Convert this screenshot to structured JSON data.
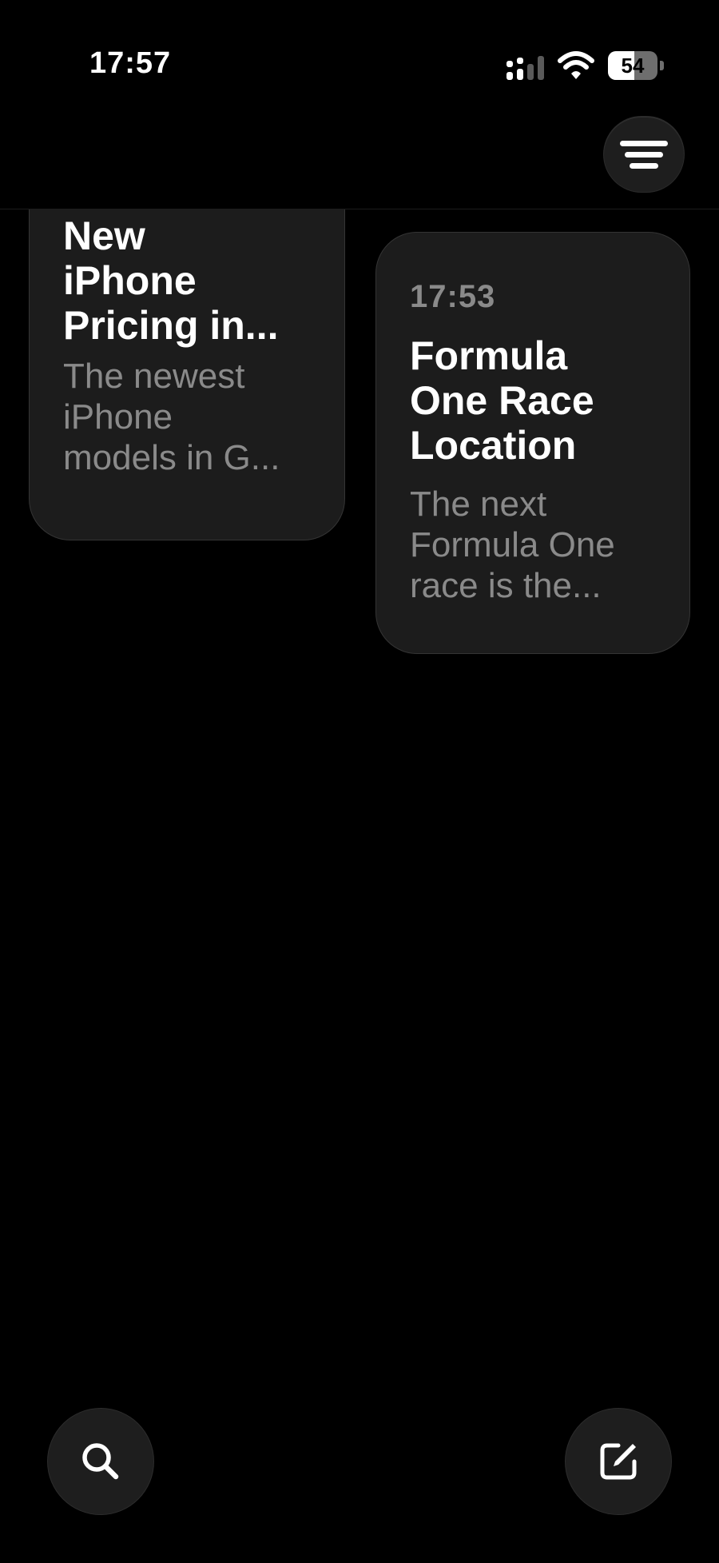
{
  "status_bar": {
    "time": "17:57",
    "battery_percent": "54",
    "battery_level": 54,
    "icons": [
      "cellular-signal-icon",
      "wifi-icon",
      "battery-icon"
    ]
  },
  "header": {
    "filter_icon": "filter-icon"
  },
  "notes": [
    {
      "title_lines": [
        "New",
        "iPhone",
        "Pricing in..."
      ],
      "preview_lines": [
        "The newest",
        "iPhone",
        "models in G..."
      ]
    },
    {
      "time": "17:53",
      "title_lines": [
        "Formula",
        "One Race",
        "Location"
      ],
      "preview_lines": [
        "The next",
        "Formula One",
        "race is the..."
      ]
    }
  ],
  "toolbar": {
    "search_icon": "search-icon",
    "compose_icon": "compose-icon"
  },
  "colors": {
    "background": "#000000",
    "card": "#1c1c1c",
    "secondary_text": "#8a8a8a",
    "primary_text": "#ffffff"
  }
}
